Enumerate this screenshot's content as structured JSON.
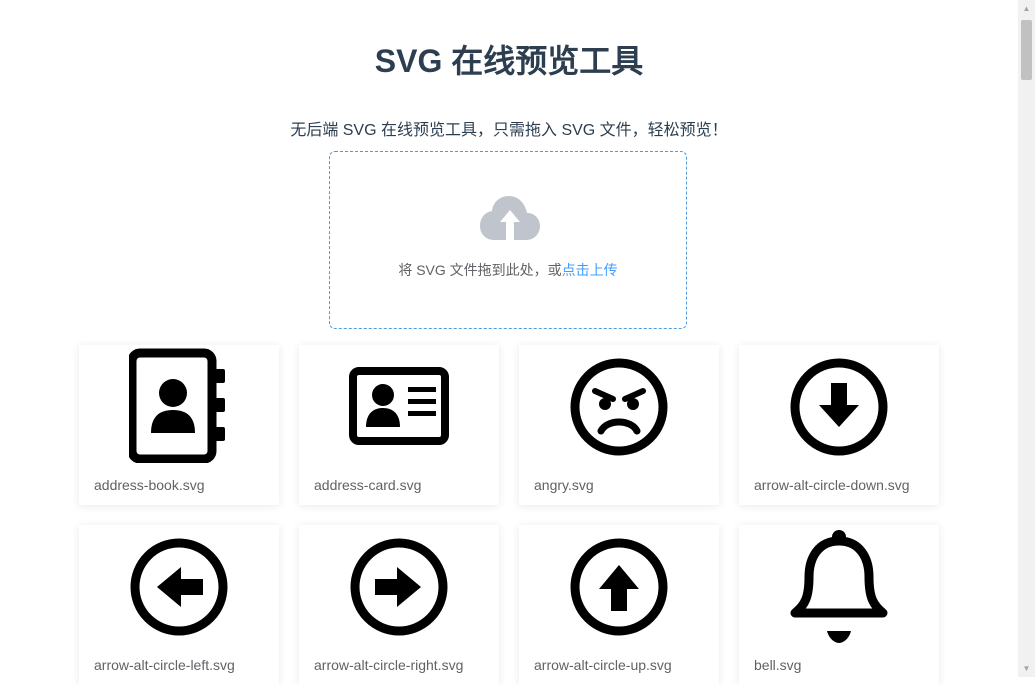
{
  "header": {
    "title": "SVG 在线预览工具",
    "subtitle": "无后端 SVG 在线预览工具，只需拖入 SVG 文件，轻松预览！"
  },
  "upload": {
    "icon": "cloud-upload-icon",
    "hint": "将 SVG 文件拖到此处，或",
    "link": "点击上传"
  },
  "files": [
    {
      "name": "address-book.svg",
      "icon": "address-book-icon"
    },
    {
      "name": "address-card.svg",
      "icon": "address-card-icon"
    },
    {
      "name": "angry.svg",
      "icon": "angry-face-icon"
    },
    {
      "name": "arrow-alt-circle-down.svg",
      "icon": "arrow-circle-down-icon"
    },
    {
      "name": "arrow-alt-circle-left.svg",
      "icon": "arrow-circle-left-icon"
    },
    {
      "name": "arrow-alt-circle-right.svg",
      "icon": "arrow-circle-right-icon"
    },
    {
      "name": "arrow-alt-circle-up.svg",
      "icon": "arrow-circle-up-icon"
    },
    {
      "name": "bell.svg",
      "icon": "bell-icon"
    }
  ],
  "colors": {
    "title": "#2c3e50",
    "accent": "#409eff",
    "dropzone_border": "#4a9be0",
    "upload_icon": "#c0c4cc"
  }
}
